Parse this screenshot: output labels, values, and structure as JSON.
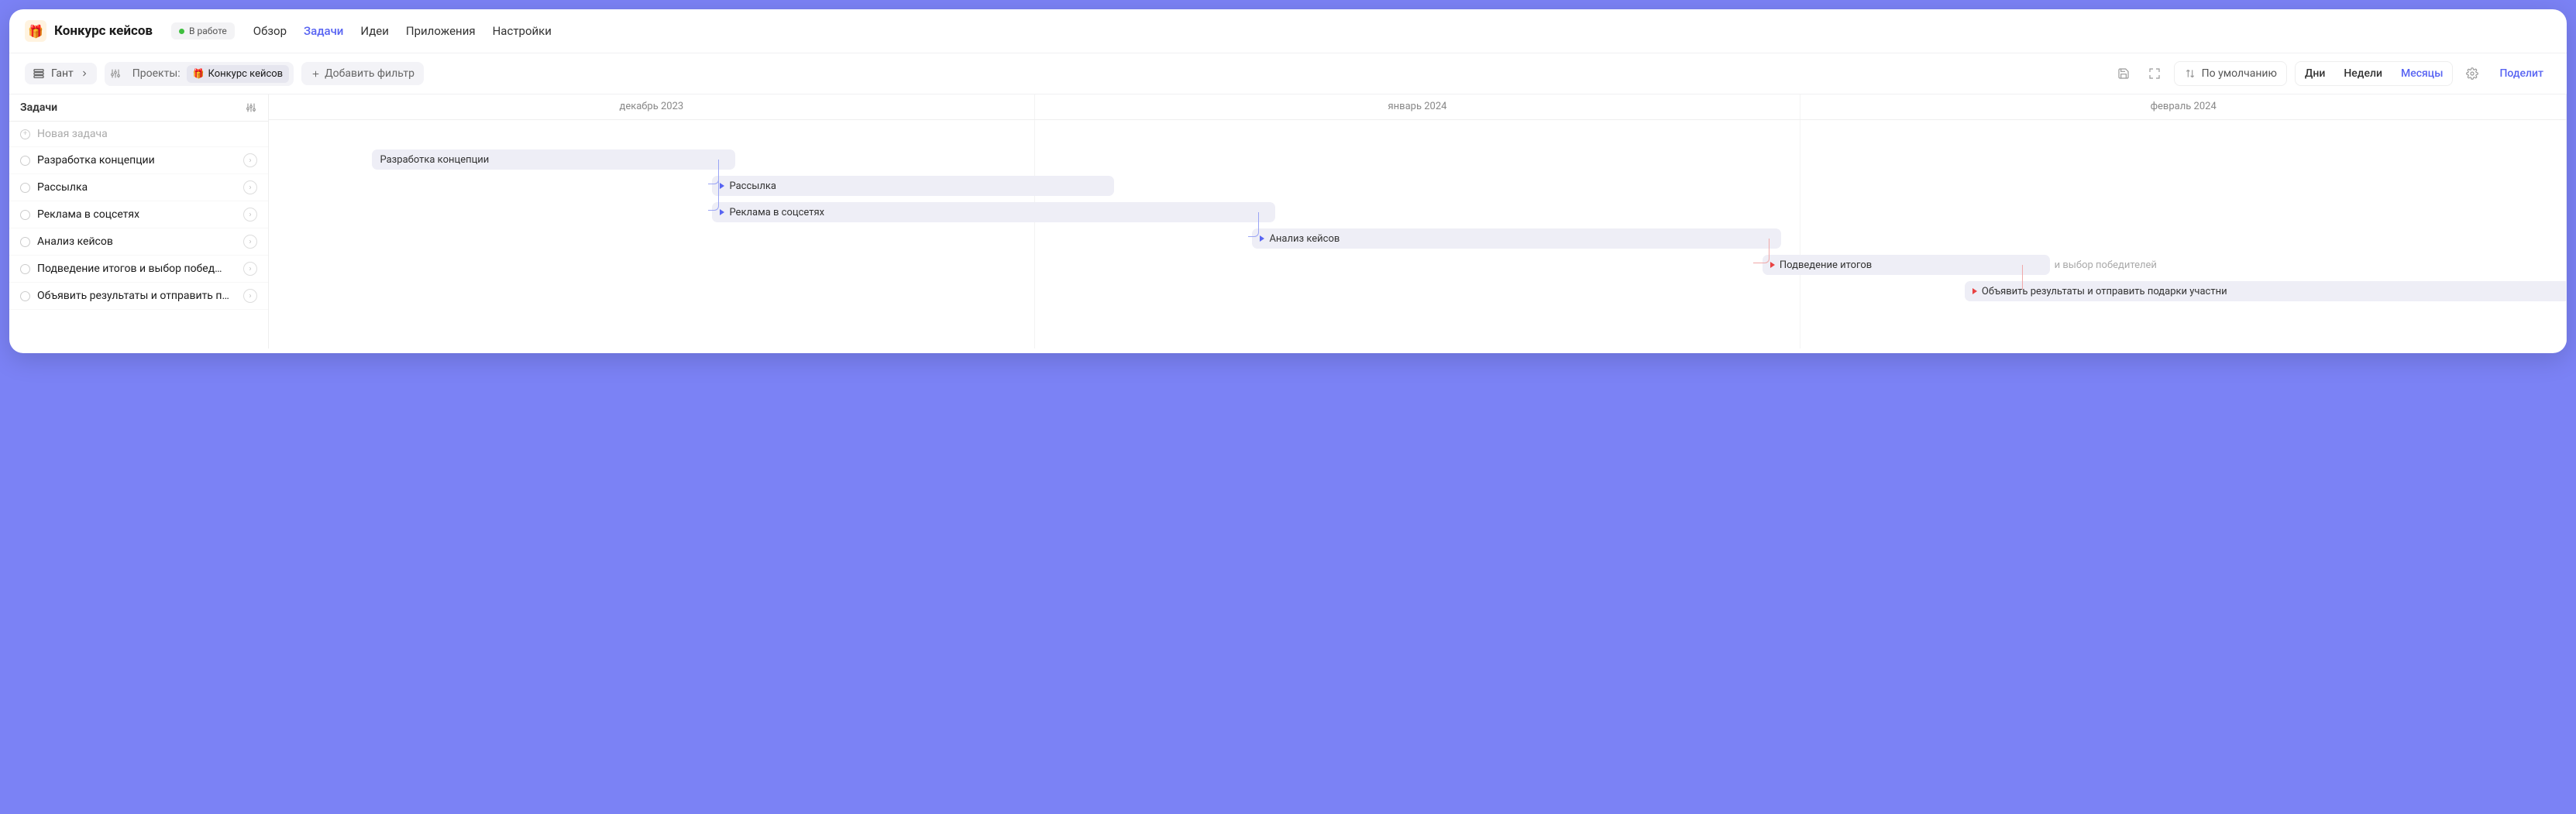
{
  "header": {
    "project_icon": "🎁",
    "project_title": "Конкурс кейсов",
    "status_label": "В работе",
    "nav": {
      "overview": "Обзор",
      "tasks": "Задачи",
      "ideas": "Идеи",
      "apps": "Приложения",
      "settings": "Настройки"
    }
  },
  "toolbar": {
    "view_label": "Гант",
    "projects_label": "Проекты:",
    "project_chip_icon": "🎁",
    "project_chip": "Конкурс кейсов",
    "add_filter": "Добавить фильтр",
    "sort_label": "По умолчанию",
    "zoom": {
      "days": "Дни",
      "weeks": "Недели",
      "months": "Месяцы"
    },
    "share": "Поделит"
  },
  "sidebar": {
    "header": "Задачи",
    "new_task": "Новая задача",
    "tasks": [
      "Разработка концепции",
      "Рассылка",
      "Реклама в соцсетях",
      "Анализ кейсов",
      "Подведение итогов и выбор побед…",
      "Объявить результаты и отправить п…"
    ]
  },
  "timeline": {
    "columns": [
      "декабрь 2023",
      "январь 2024",
      "февраль 2024"
    ],
    "bars": [
      {
        "label": "Разработка концепции",
        "overflow": "",
        "dep": ""
      },
      {
        "label": "Рассылка",
        "overflow": "",
        "dep": "blue"
      },
      {
        "label": "Реклама в соцсетях",
        "overflow": "",
        "dep": "blue"
      },
      {
        "label": "Анализ кейсов",
        "overflow": "",
        "dep": "blue"
      },
      {
        "label": "Подведение итогов",
        "overflow": "и выбор победителей",
        "dep": "red"
      },
      {
        "label": "Объявить результаты и отправить подарки участни",
        "overflow": "",
        "dep": "red"
      }
    ]
  }
}
